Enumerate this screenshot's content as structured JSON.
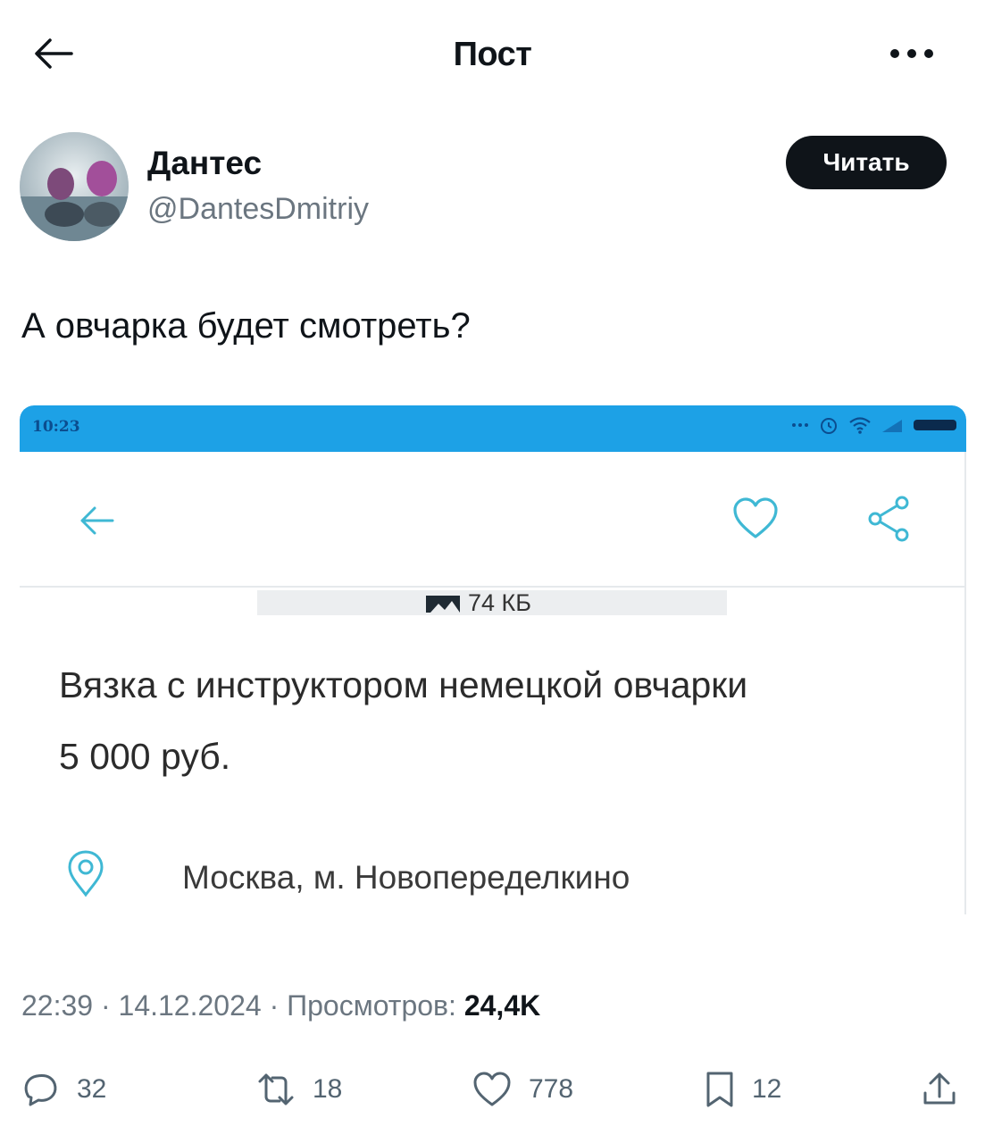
{
  "header": {
    "title": "Пост"
  },
  "author": {
    "name": "Дантес",
    "handle": "@DantesDmitriy",
    "follow_label": "Читать"
  },
  "post": {
    "text": "А овчарка будет смотреть?"
  },
  "embedded_screenshot": {
    "status_time": "10:23",
    "image_size": "74 КБ",
    "listing_title": "Вязка с инструктором немецкой овчарки",
    "listing_price": "5 000 руб.",
    "listing_location": "Москва, м. Новопеределкино",
    "accent_color": "#1da1e6",
    "icon_color": "#3fb8d4"
  },
  "meta": {
    "time": "22:39",
    "date": "14.12.2024",
    "views_label": "Просмотров:",
    "views_value": "24,4K"
  },
  "actions": {
    "replies": "32",
    "reposts": "18",
    "likes": "778",
    "bookmarks": "12"
  }
}
